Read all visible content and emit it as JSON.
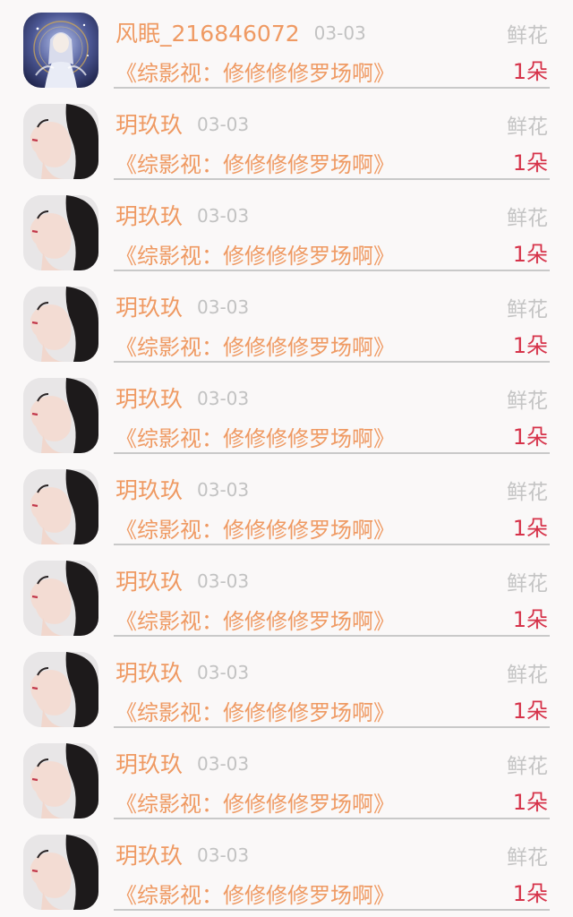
{
  "gift_list": [
    {
      "user": "风眠_216846072",
      "date": "03-03",
      "gift_type": "鲜花",
      "book": "《综影视：修修修修罗场啊》",
      "count": "1朵",
      "avatar": "anime-girl-avatar-icon"
    },
    {
      "user": "玥玖玖",
      "date": "03-03",
      "gift_type": "鲜花",
      "book": "《综影视：修修修修罗场啊》",
      "count": "1朵",
      "avatar": "woman-profile-avatar-icon"
    },
    {
      "user": "玥玖玖",
      "date": "03-03",
      "gift_type": "鲜花",
      "book": "《综影视：修修修修罗场啊》",
      "count": "1朵",
      "avatar": "woman-profile-avatar-icon"
    },
    {
      "user": "玥玖玖",
      "date": "03-03",
      "gift_type": "鲜花",
      "book": "《综影视：修修修修罗场啊》",
      "count": "1朵",
      "avatar": "woman-profile-avatar-icon"
    },
    {
      "user": "玥玖玖",
      "date": "03-03",
      "gift_type": "鲜花",
      "book": "《综影视：修修修修罗场啊》",
      "count": "1朵",
      "avatar": "woman-profile-avatar-icon"
    },
    {
      "user": "玥玖玖",
      "date": "03-03",
      "gift_type": "鲜花",
      "book": "《综影视：修修修修罗场啊》",
      "count": "1朵",
      "avatar": "woman-profile-avatar-icon"
    },
    {
      "user": "玥玖玖",
      "date": "03-03",
      "gift_type": "鲜花",
      "book": "《综影视：修修修修罗场啊》",
      "count": "1朵",
      "avatar": "woman-profile-avatar-icon"
    },
    {
      "user": "玥玖玖",
      "date": "03-03",
      "gift_type": "鲜花",
      "book": "《综影视：修修修修罗场啊》",
      "count": "1朵",
      "avatar": "woman-profile-avatar-icon"
    },
    {
      "user": "玥玖玖",
      "date": "03-03",
      "gift_type": "鲜花",
      "book": "《综影视：修修修修罗场啊》",
      "count": "1朵",
      "avatar": "woman-profile-avatar-icon"
    },
    {
      "user": "玥玖玖",
      "date": "03-03",
      "gift_type": "鲜花",
      "book": "《综影视：修修修修罗场啊》",
      "count": "1朵",
      "avatar": "woman-profile-avatar-icon"
    }
  ],
  "colors": {
    "accent_orange": "#ef9a63",
    "count_red": "#d6334a",
    "muted_gray": "#c2c2c2",
    "background": "#faf8f8"
  }
}
